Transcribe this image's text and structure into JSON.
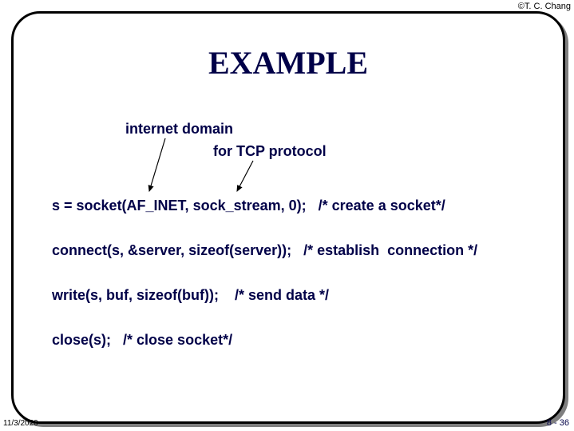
{
  "meta": {
    "copyright": "©T. C. Chang",
    "date": "11/3/2020",
    "page": "8 - 36"
  },
  "title": "EXAMPLE",
  "labels": {
    "internet_domain": "internet domain",
    "tcp_protocol": "for TCP protocol"
  },
  "code": {
    "line1": "s = socket(AF_INET, sock_stream, 0);   /* create a socket*/",
    "line2": "connect(s, &server, sizeof(server));   /* establish  connection */",
    "line3": "write(s, buf, sizeof(buf));    /* send data */",
    "line4": "close(s);   /* close socket*/"
  }
}
